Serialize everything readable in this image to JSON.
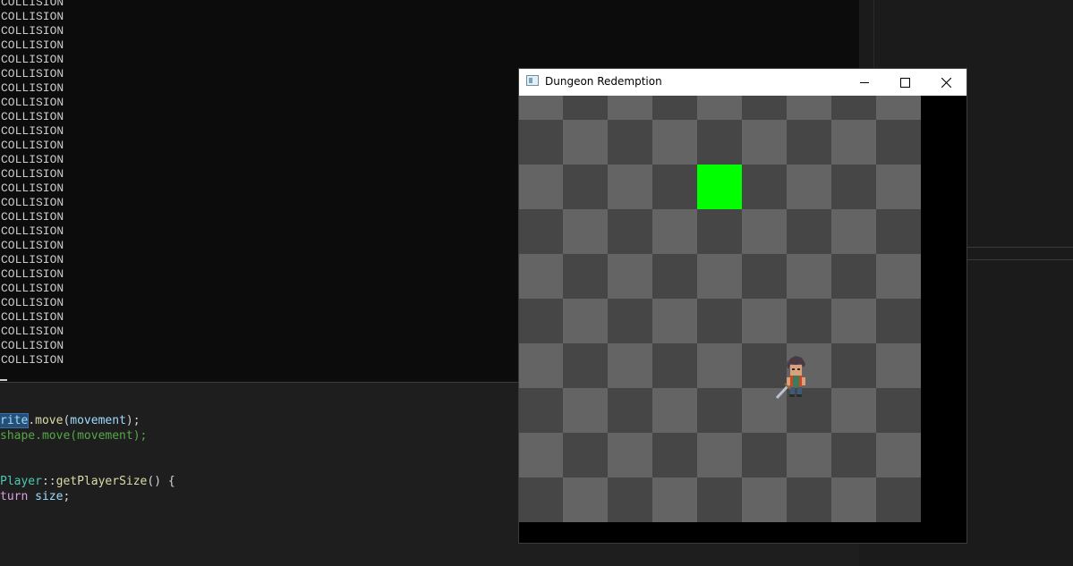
{
  "console": {
    "lines": [
      "COLLISION",
      "COLLISION",
      "COLLISION",
      "COLLISION",
      "COLLISION",
      "COLLISION",
      "COLLISION",
      "COLLISION",
      "COLLISION",
      "COLLISION",
      "COLLISION",
      "COLLISION",
      "COLLISION",
      "COLLISION",
      "COLLISION",
      "COLLISION",
      "COLLISION",
      "COLLISION",
      "COLLISION",
      "COLLISION",
      "COLLISION",
      "COLLISION",
      "COLLISION",
      "COLLISION",
      "COLLISION",
      "COLLISION"
    ]
  },
  "code": {
    "line1": {
      "obj": "rite",
      "dot": ".",
      "fn": "move",
      "open": "(",
      "arg": "movement",
      "close": ");"
    },
    "line2": {
      "text": "shape.move(movement);"
    },
    "line3": {
      "type": "Player",
      "sep": "::",
      "fn": "getPlayerSize",
      "rest": "() {"
    },
    "line4": {
      "kw": "turn",
      "space": " ",
      "var": "size",
      "end": ";"
    }
  },
  "window": {
    "title": "Dungeon Redemption",
    "icons": {
      "app": "app-window-icon",
      "minimize": "minimize-icon",
      "maximize": "maximize-icon",
      "close": "close-icon"
    }
  },
  "game": {
    "grid_cols": 9,
    "grid_rows": 10,
    "light_color": "#646464",
    "dark_color": "#464646",
    "goal_color": "#00ff00",
    "goal_cell": {
      "col": 4,
      "row": 2
    },
    "player_cell": {
      "col": 6,
      "row": 6
    }
  }
}
